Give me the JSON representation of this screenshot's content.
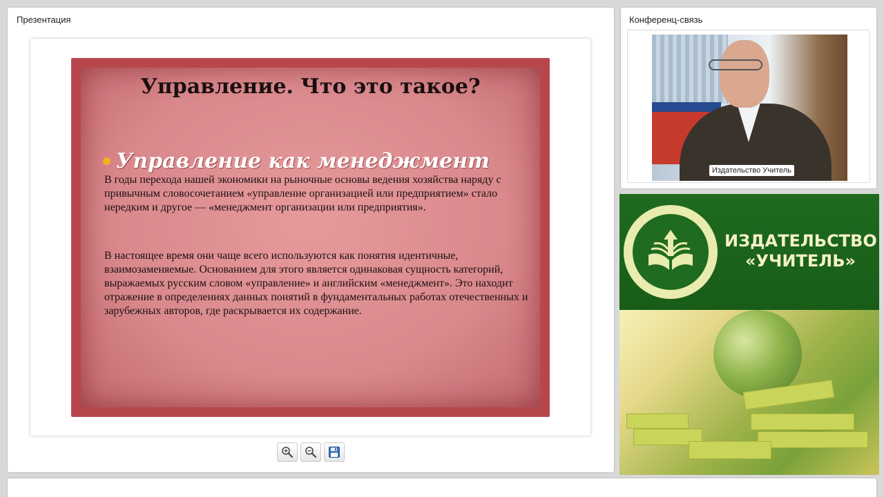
{
  "presentation": {
    "panel_title": "Презентация",
    "slide": {
      "title": "Управление. Что это такое?",
      "bullet": "Управление как менеджмент",
      "paragraph_1": "В годы перехода нашей экономики на рыночные основы ведения хозяйства наряду с привычным словосочетанием «управление организацией или предприятием» стало нередким и другое — «менеджмент организации или предприятия».",
      "paragraph_2": "В настоящее время они чаще всего используются как понятия идентичные, взаимозаменяемые. Основанием для этого является одинаковая сущность категорий, выражаемых русским словом «управление» и английским «менеджмент». Это находит отражение в определениях данных понятий в фундаментальных работах отечественных и зарубежных авторов, где раскрывается их содержание."
    },
    "toolbar": {
      "zoom_in_icon": "magnifier-plus-icon",
      "zoom_out_icon": "magnifier-minus-icon",
      "save_icon": "floppy-disk-icon"
    }
  },
  "conference": {
    "panel_title": "Конференц-связь",
    "video_label": "Издательство Учитель"
  },
  "brand": {
    "name_line_1": "ИЗДАТЕЛЬСТВО",
    "name_line_2": "«УЧИТЕЛЬ»"
  },
  "colors": {
    "slide_background": "#d9888c",
    "slide_border": "#b8474d",
    "bullet": "#f3b41b",
    "brand_green": "#1f6b1f",
    "brand_text": "#f4f1c8"
  }
}
